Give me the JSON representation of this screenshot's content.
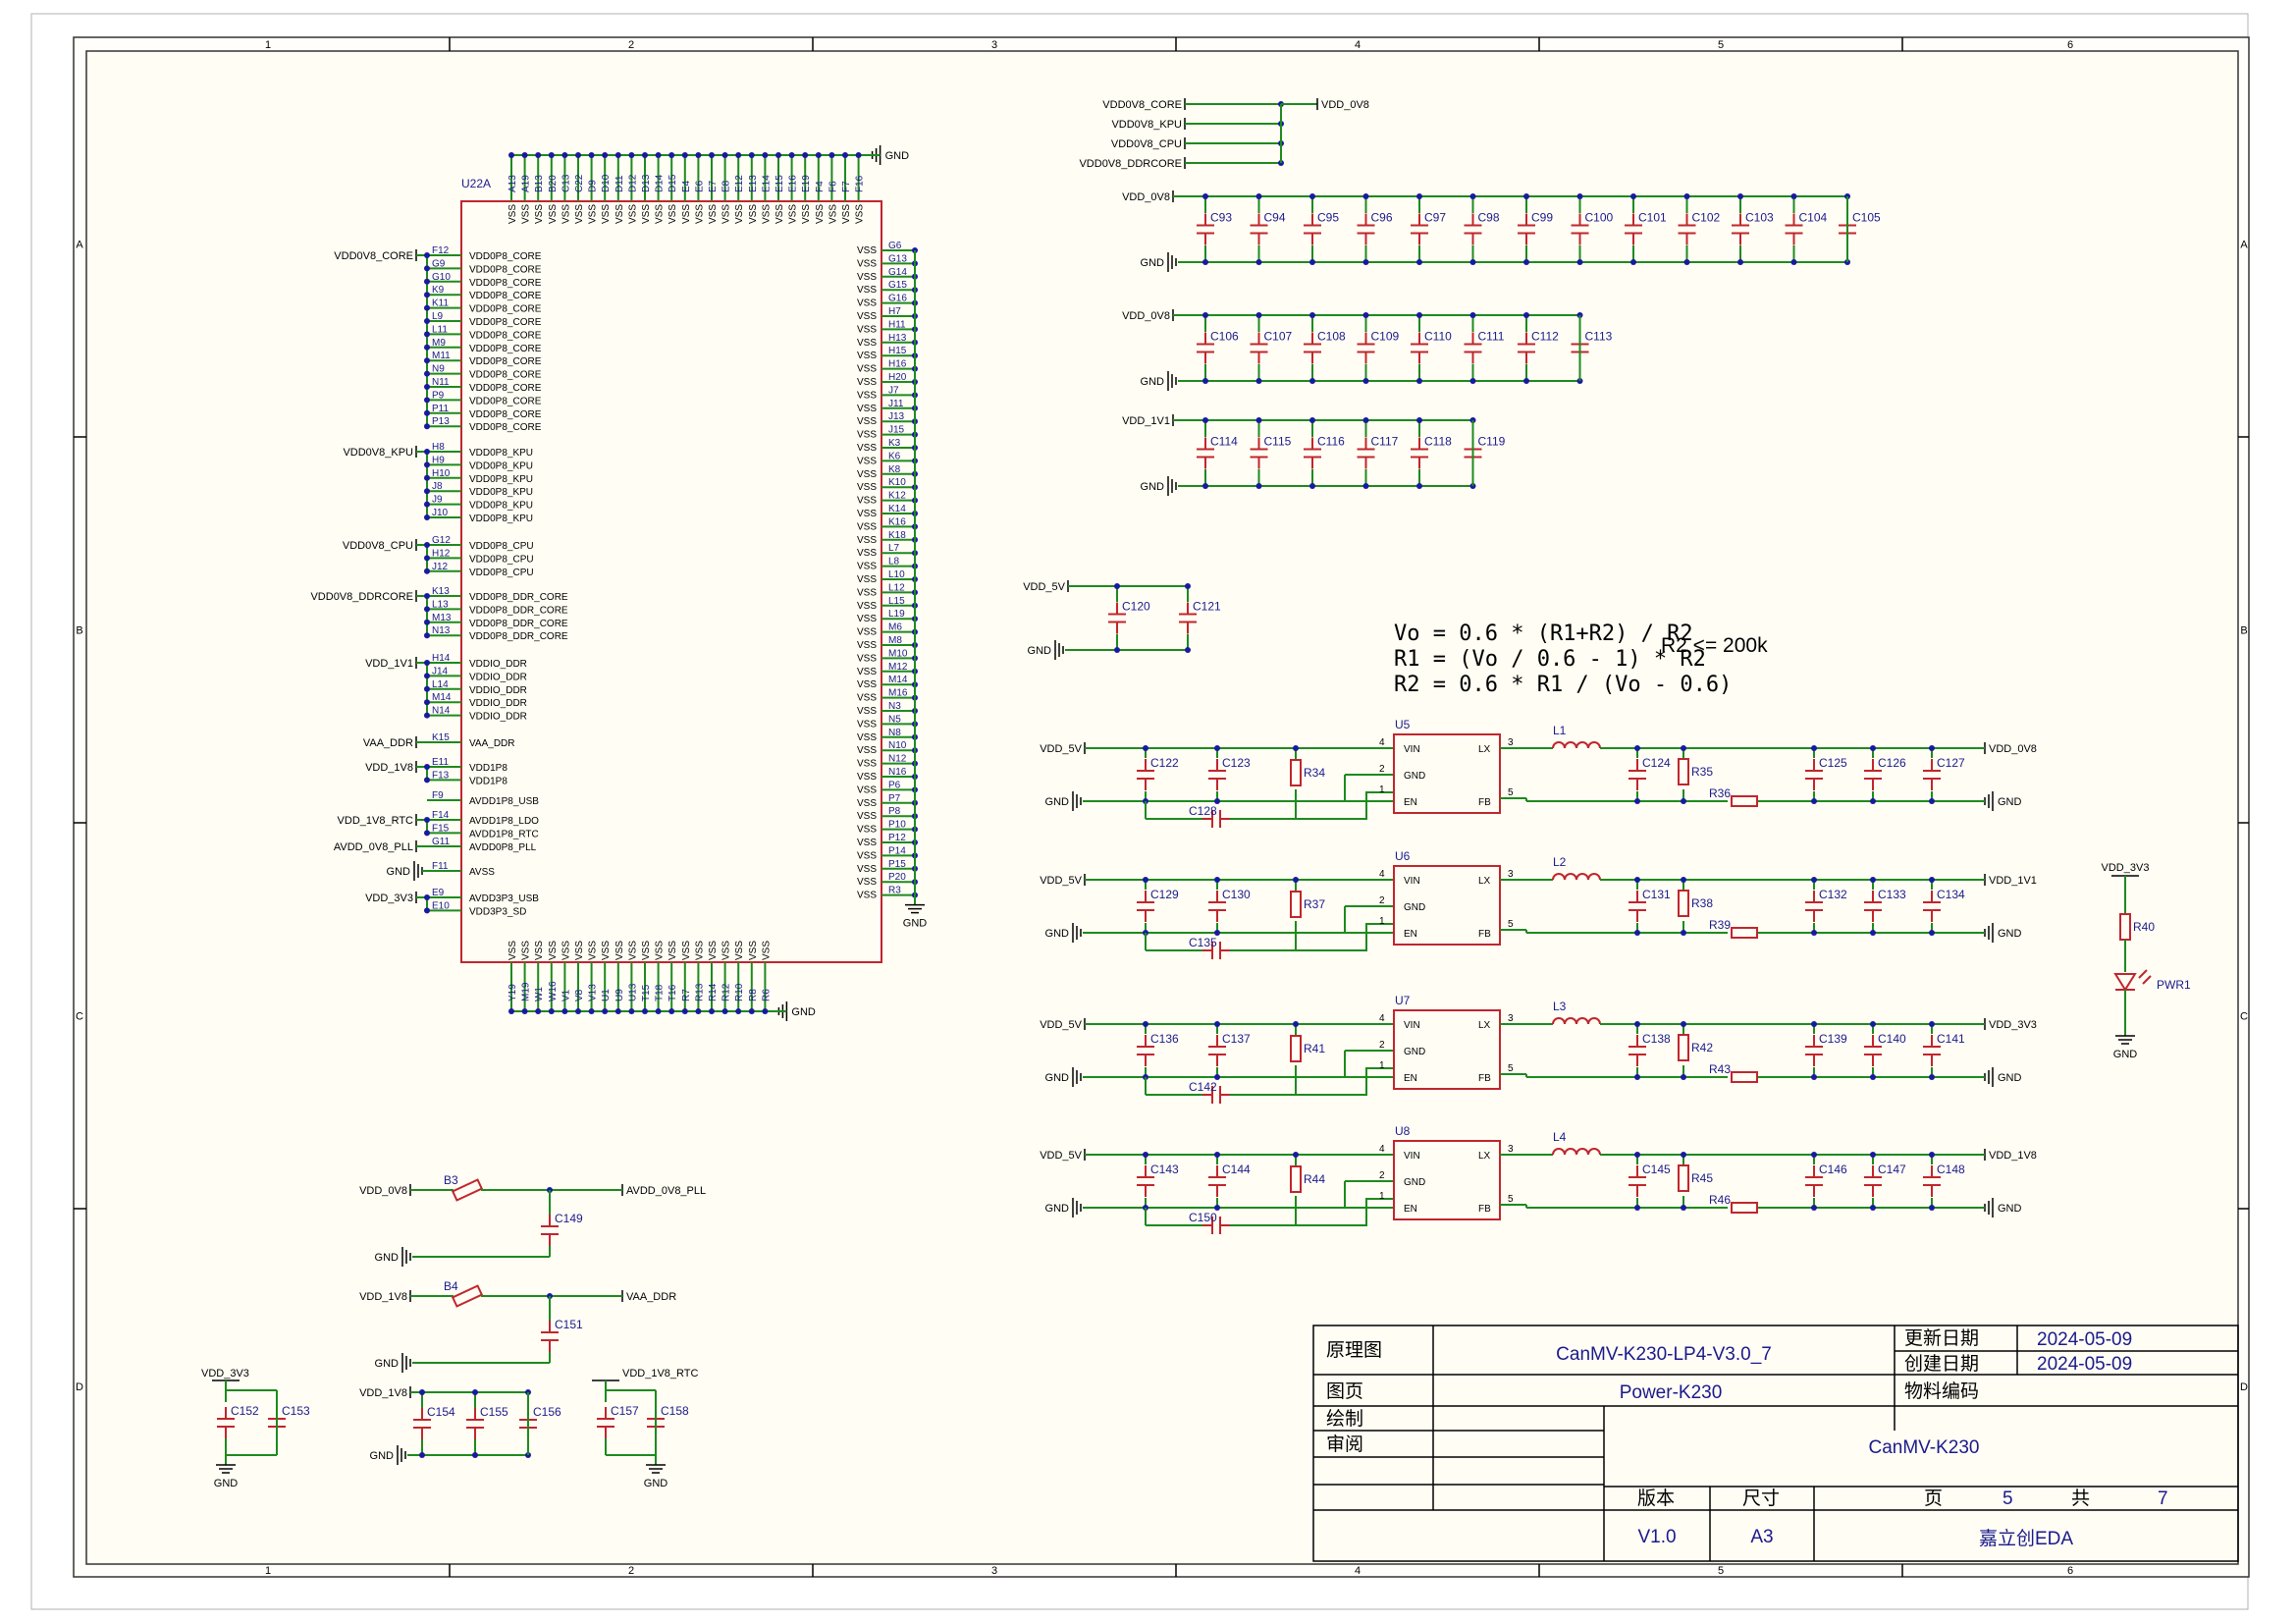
{
  "border": {
    "cols": [
      "1",
      "2",
      "3",
      "4",
      "5",
      "6"
    ],
    "rows": [
      "A",
      "B",
      "C",
      "D"
    ]
  },
  "u22a": {
    "designator": "U22A",
    "top_pins": [
      "A13",
      "A19",
      "B13",
      "B20",
      "C13",
      "C22",
      "D9",
      "D10",
      "D11",
      "D12",
      "D13",
      "D14",
      "D15",
      "E4",
      "E6",
      "E7",
      "E8",
      "E12",
      "E13",
      "E14",
      "E15",
      "E16",
      "E19",
      "F4",
      "F6",
      "F7",
      "F16"
    ],
    "bottom_pins": [
      "Y19",
      "M19",
      "W1",
      "W16",
      "V1",
      "V8",
      "V13",
      "U1",
      "U9",
      "U13",
      "T15",
      "T18",
      "T16",
      "R7",
      "R13",
      "R14",
      "R12",
      "R10",
      "R8",
      "R6"
    ],
    "right_pins": [
      "G6",
      "G13",
      "G14",
      "G15",
      "G16",
      "H7",
      "H11",
      "H13",
      "H15",
      "H16",
      "H20",
      "J7",
      "J11",
      "J13",
      "J15",
      "K3",
      "K6",
      "K8",
      "K10",
      "K12",
      "K14",
      "K16",
      "K18",
      "L7",
      "L8",
      "L10",
      "L12",
      "L15",
      "L19",
      "M6",
      "M8",
      "M10",
      "M12",
      "M14",
      "M16",
      "N3",
      "N5",
      "N8",
      "N10",
      "N12",
      "N16",
      "P6",
      "P7",
      "P8",
      "P10",
      "P12",
      "P14",
      "P15",
      "P20",
      "R3"
    ],
    "left_groups": [
      {
        "net": "VDD0V8_CORE",
        "pins": [
          [
            "F12",
            "VDD0P8_CORE"
          ],
          [
            "G9",
            "VDD0P8_CORE"
          ],
          [
            "G10",
            "VDD0P8_CORE"
          ],
          [
            "K9",
            "VDD0P8_CORE"
          ],
          [
            "K11",
            "VDD0P8_CORE"
          ],
          [
            "L9",
            "VDD0P8_CORE"
          ],
          [
            "L11",
            "VDD0P8_CORE"
          ],
          [
            "M9",
            "VDD0P8_CORE"
          ],
          [
            "M11",
            "VDD0P8_CORE"
          ],
          [
            "N9",
            "VDD0P8_CORE"
          ],
          [
            "N11",
            "VDD0P8_CORE"
          ],
          [
            "P9",
            "VDD0P8_CORE"
          ],
          [
            "P11",
            "VDD0P8_CORE"
          ],
          [
            "P13",
            "VDD0P8_CORE"
          ]
        ]
      },
      {
        "net": "VDD0V8_KPU",
        "pins": [
          [
            "H8",
            "VDD0P8_KPU"
          ],
          [
            "H9",
            "VDD0P8_KPU"
          ],
          [
            "H10",
            "VDD0P8_KPU"
          ],
          [
            "J8",
            "VDD0P8_KPU"
          ],
          [
            "J9",
            "VDD0P8_KPU"
          ],
          [
            "J10",
            "VDD0P8_KPU"
          ]
        ]
      },
      {
        "net": "VDD0V8_CPU",
        "pins": [
          [
            "G12",
            "VDD0P8_CPU"
          ],
          [
            "H12",
            "VDD0P8_CPU"
          ],
          [
            "J12",
            "VDD0P8_CPU"
          ]
        ]
      },
      {
        "net": "VDD0V8_DDRCORE",
        "pins": [
          [
            "K13",
            "VDD0P8_DDR_CORE"
          ],
          [
            "L13",
            "VDD0P8_DDR_CORE"
          ],
          [
            "M13",
            "VDD0P8_DDR_CORE"
          ],
          [
            "N13",
            "VDD0P8_DDR_CORE"
          ]
        ]
      },
      {
        "net": "VDD_1V1",
        "pins": [
          [
            "H14",
            "VDDIO_DDR"
          ],
          [
            "J14",
            "VDDIO_DDR"
          ],
          [
            "L14",
            "VDDIO_DDR"
          ],
          [
            "M14",
            "VDDIO_DDR"
          ],
          [
            "N14",
            "VDDIO_DDR"
          ]
        ]
      },
      {
        "net": "VAA_DDR",
        "pins": [
          [
            "K15",
            "VAA_DDR"
          ]
        ]
      },
      {
        "net": "VDD_1V8",
        "pins": [
          [
            "E11",
            "VDD1P8"
          ],
          [
            "F13",
            "VDD1P8"
          ]
        ]
      },
      {
        "net": "",
        "pins": [
          [
            "F9",
            "AVDD1P8_USB"
          ]
        ]
      },
      {
        "net": "VDD_1V8_RTC",
        "pins": [
          [
            "F14",
            "AVDD1P8_LDO"
          ],
          [
            "F15",
            "AVDD1P8_RTC"
          ]
        ]
      },
      {
        "net": "AVDD_0V8_PLL",
        "pins": [
          [
            "G11",
            "AVDD0P8_PLL"
          ]
        ]
      },
      {
        "net": "GND",
        "pins": [
          [
            "F11",
            "AVSS"
          ]
        ]
      },
      {
        "net": "VDD_3V3",
        "pins": [
          [
            "E9",
            "AVDD3P3_USB"
          ],
          [
            "E10",
            "VDD3P3_SD"
          ]
        ]
      }
    ],
    "vss": "VSS",
    "gnd": "GND"
  },
  "rails": {
    "vdd_0v8": "VDD_0V8",
    "sources": [
      "VDD0V8_CORE",
      "VDD0V8_KPU",
      "VDD0V8_CPU",
      "VDD0V8_DDRCORE"
    ]
  },
  "cap_banks": [
    {
      "net": "VDD_0V8",
      "caps": [
        "C93",
        "C94",
        "C95",
        "C96",
        "C97",
        "C98",
        "C99",
        "C100",
        "C101",
        "C102",
        "C103",
        "C104",
        "C105"
      ]
    },
    {
      "net": "VDD_0V8",
      "caps": [
        "C106",
        "C107",
        "C108",
        "C109",
        "C110",
        "C111",
        "C112",
        "C113"
      ]
    },
    {
      "net": "VDD_1V1",
      "caps": [
        "C114",
        "C115",
        "C116",
        "C117",
        "C118",
        "C119"
      ]
    }
  ],
  "bulk": {
    "net": "VDD_5V",
    "caps": [
      "C120",
      "C121"
    ]
  },
  "gnd": "GND",
  "formulas": [
    "Vo = 0.6 * (R1+R2) / R2",
    "R1 = (Vo / 0.6 - 1) * R2",
    "R2 = 0.6 * R1 / (Vo - 0.6)",
    "R2 <= 200k"
  ],
  "regulators": [
    {
      "u": "U5",
      "l": "L1",
      "in": "VDD_5V",
      "out": "VDD_0V8",
      "cin1": "C122",
      "cin2": "C123",
      "cen": "C128",
      "ren": "R34",
      "cff": "C124",
      "rtop": "R35",
      "rbot": "R36",
      "cout1": "C125",
      "cout2": "C126",
      "cout3": "C127"
    },
    {
      "u": "U6",
      "l": "L2",
      "in": "VDD_5V",
      "out": "VDD_1V1",
      "cin1": "C129",
      "cin2": "C130",
      "cen": "C135",
      "ren": "R37",
      "cff": "C131",
      "rtop": "R38",
      "rbot": "R39",
      "cout1": "C132",
      "cout2": "C133",
      "cout3": "C134"
    },
    {
      "u": "U7",
      "l": "L3",
      "in": "VDD_5V",
      "out": "VDD_3V3",
      "cin1": "C136",
      "cin2": "C137",
      "cen": "C142",
      "ren": "R41",
      "cff": "C138",
      "rtop": "R42",
      "rbot": "R43",
      "cout1": "C139",
      "cout2": "C140",
      "cout3": "C141"
    },
    {
      "u": "U8",
      "l": "L4",
      "in": "VDD_5V",
      "out": "VDD_1V8",
      "cin1": "C143",
      "cin2": "C144",
      "cen": "C150",
      "ren": "R44",
      "cff": "C145",
      "rtop": "R45",
      "rbot": "R46",
      "cout1": "C146",
      "cout2": "C147",
      "cout3": "C148"
    }
  ],
  "reg_pins": {
    "vin": "VIN",
    "gnd": "GND",
    "en": "EN",
    "lx": "LX",
    "fb": "FB",
    "n4": "4",
    "n2": "2",
    "n1": "1",
    "n3": "3",
    "n5": "5"
  },
  "led": {
    "net": "VDD_3V3",
    "r": "R40",
    "d": "PWR1",
    "gnd": "GND"
  },
  "filters": [
    {
      "in": "VDD_0V8",
      "bead": "B3",
      "out": "AVDD_0V8_PLL",
      "cap": "C149"
    },
    {
      "in": "VDD_1V8",
      "bead": "B4",
      "out": "VAA_DDR",
      "cap": "C151"
    }
  ],
  "bottom_caps": [
    {
      "net": "VDD_3V3",
      "caps": [
        "C152",
        "C153"
      ]
    },
    {
      "net": "VDD_1V8",
      "caps": [
        "C154",
        "C155",
        "C156"
      ]
    },
    {
      "net": "VDD_1V8_RTC",
      "caps": [
        "C157",
        "C158"
      ]
    }
  ],
  "title_block": {
    "label_schematic": "原理图",
    "project": "CanMV-K230-LP4-V3.0_7",
    "label_updated": "更新日期",
    "updated": "2024-05-09",
    "label_created": "创建日期",
    "created": "2024-05-09",
    "label_page": "图页",
    "page_name": "Power-K230",
    "label_part": "物料编码",
    "label_drawn": "绘制",
    "label_review": "审阅",
    "board": "CanMV-K230",
    "label_version": "版本",
    "label_size": "尺寸",
    "label_pg": "页",
    "label_total": "共",
    "version": "V1.0",
    "size": "A3",
    "page": "5",
    "total": "7",
    "tool": "嘉立创EDA"
  }
}
